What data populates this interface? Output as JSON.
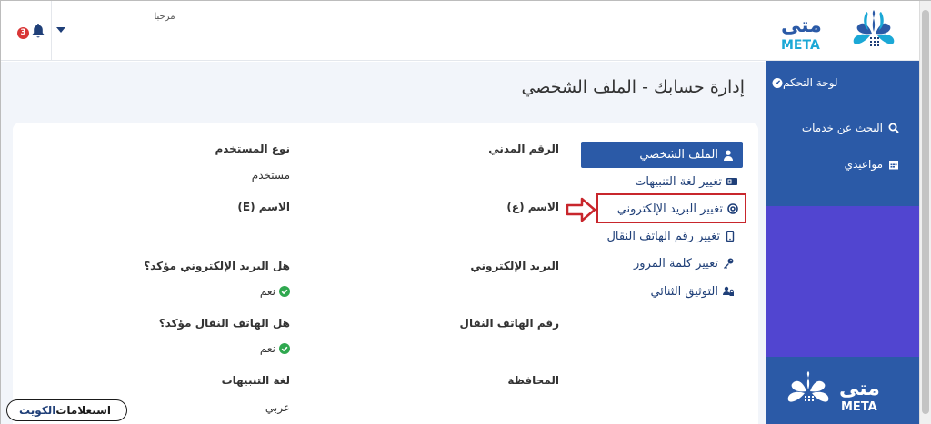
{
  "header": {
    "welcome": "مرحبا",
    "notifications_count": "3",
    "logo_text": "META",
    "logo_arabic": "متى"
  },
  "sidebar": {
    "dashboard": "لوحة التحكم",
    "search_services": "البحث عن خدمات",
    "my_appointments": "مواعيدي"
  },
  "page": {
    "title": "إدارة حسابك - الملف الشخصي"
  },
  "profile_menu": {
    "profile": "الملف الشخصي",
    "notification_language": "تغيير لغة التنبيهات",
    "change_email": "تغيير البريد الإلكتروني",
    "change_phone": "تغيير رقم الهاتف النقال",
    "change_password": "تغيير كلمة المرور",
    "two_factor": "التوثيق الثنائي"
  },
  "fields": {
    "civil_id_label": "الرقم المدني",
    "user_type_label": "نوع المستخدم",
    "user_type_value": "مستخدم",
    "name_ar_label": "الاسم (ع)",
    "name_en_label": "الاسم (E)",
    "email_label": "البريد الإلكتروني",
    "email_verified_label": "هل البريد الإلكتروني مؤكد؟",
    "email_verified_value": "نعم",
    "phone_label": "رقم الهاتف النقال",
    "phone_verified_label": "هل الهاتف النقال مؤكد؟",
    "phone_verified_value": "نعم",
    "governorate_label": "المحافظة",
    "notification_language_label": "لغة التنبيهات",
    "notification_language_value": "عربي"
  },
  "watermark": {
    "part1": "استعلامات",
    "part2": "الكويت"
  },
  "colors": {
    "primary_blue": "#2b5aa7",
    "purple": "#5145d0",
    "highlight_red": "#c8262c",
    "verified_green": "#2fa84f",
    "badge_red": "#d93636"
  },
  "icons": {
    "dashboard": "tachometer-icon",
    "search": "search-icon",
    "calendar": "calendar-icon",
    "user": "user-icon",
    "language": "language-icon",
    "email": "at-icon",
    "phone": "mobile-icon",
    "password": "key-icon",
    "two_factor": "users-lock-icon",
    "verified": "check-circle-icon"
  }
}
